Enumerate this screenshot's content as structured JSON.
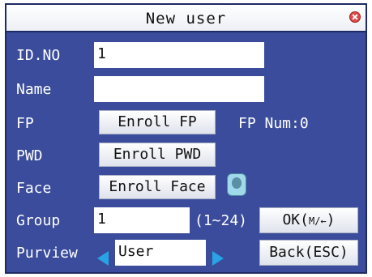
{
  "window": {
    "title": "New user",
    "close_icon": "close-icon"
  },
  "fields": {
    "id_no": {
      "label": "ID.NO",
      "value": "1"
    },
    "name": {
      "label": "Name",
      "value": ""
    },
    "fp": {
      "label": "FP",
      "button": "Enroll FP",
      "num_text": "FP Num:0"
    },
    "pwd": {
      "label": "PWD",
      "button": "Enroll PWD"
    },
    "face": {
      "label": "Face",
      "button": "Enroll Face",
      "icon": "face-icon"
    },
    "group": {
      "label": "Group",
      "value": "1",
      "range": "(1~24)"
    },
    "purview": {
      "label": "Purview",
      "value": "User"
    }
  },
  "buttons": {
    "ok_label": "OK(",
    "ok_hint": "M/←",
    "ok_suffix": ")",
    "back_label": "Back(ESC)"
  },
  "colors": {
    "background": "#3a4c9b",
    "arrow": "#2aa3e6"
  }
}
